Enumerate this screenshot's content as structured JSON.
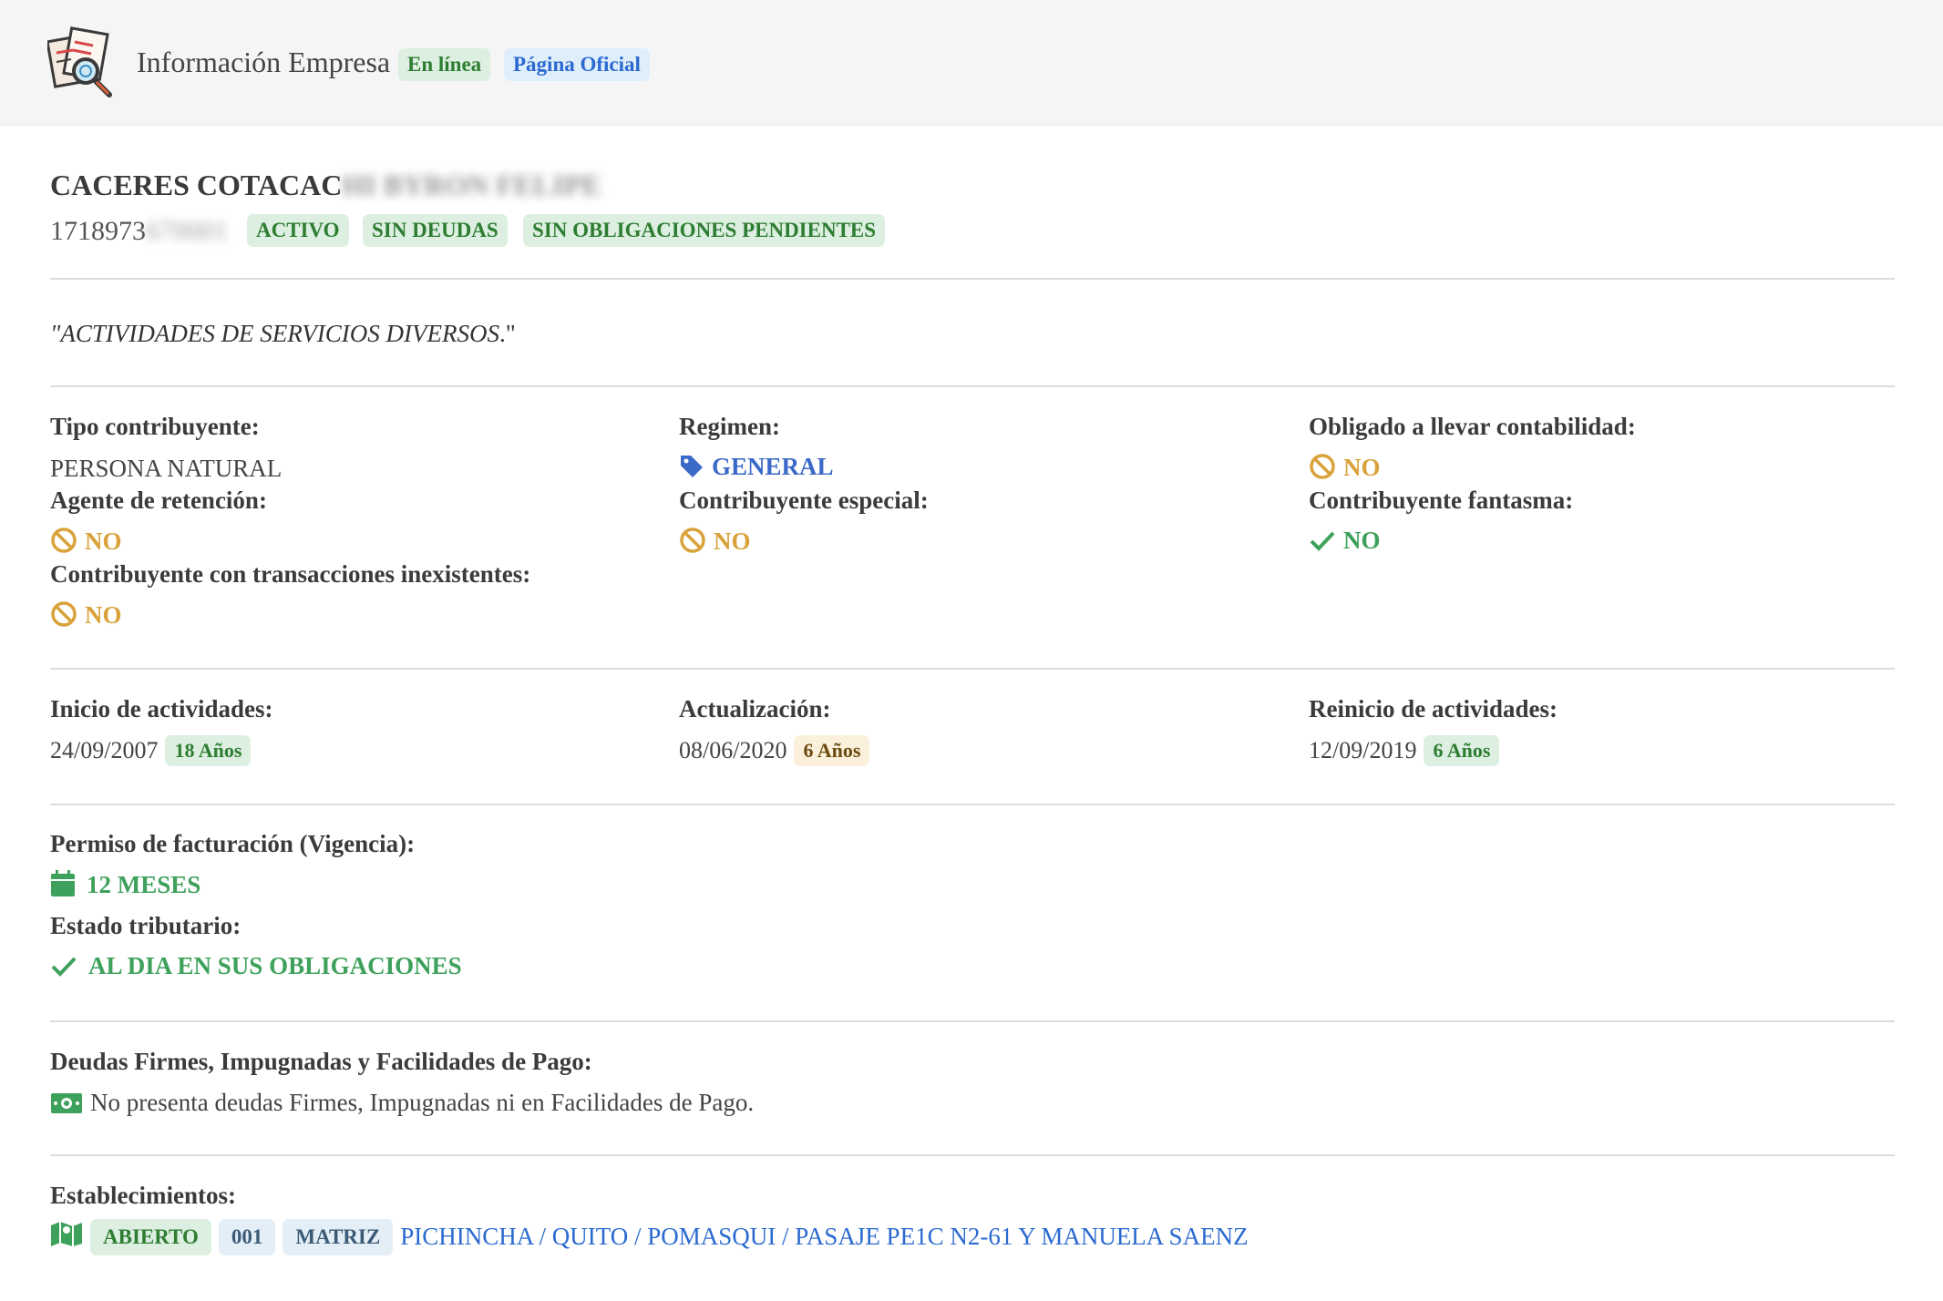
{
  "header": {
    "title": "Información Empresa",
    "badge_online": "En línea",
    "badge_official": "Página Oficial"
  },
  "company": {
    "name_visible": "CACERES COTACAC",
    "name_blurred": "HI BYRON FELIPE",
    "ruc_visible": "1718973",
    "ruc_blurred": "670001",
    "status_badges": [
      "ACTIVO",
      "SIN DEUDAS",
      "SIN OBLIGACIONES PENDIENTES"
    ],
    "activity_quote": "\"ACTIVIDADES DE SERVICIOS DIVERSOS",
    "activity_quote_tail": ".\""
  },
  "details": {
    "tipo_label": "Tipo contribuyente:",
    "tipo_value": "PERSONA NATURAL",
    "regimen_label": "Regimen:",
    "regimen_value": "GENERAL",
    "obligado_label": "Obligado a llevar contabilidad:",
    "obligado_value": "NO",
    "agente_label": "Agente de retención:",
    "agente_value": "NO",
    "especial_label": "Contribuyente especial:",
    "especial_value": "NO",
    "fantasma_label": "Contribuyente fantasma:",
    "fantasma_value": "NO",
    "inexistentes_label": "Contribuyente con transacciones inexistentes:",
    "inexistentes_value": "NO"
  },
  "dates": {
    "inicio_label": "Inicio de actividades:",
    "inicio_date": "24/09/2007",
    "inicio_age": "18 Años",
    "actualizacion_label": "Actualización:",
    "actualizacion_date": "08/06/2020",
    "actualizacion_age": "6 Años",
    "reinicio_label": "Reinicio de actividades:",
    "reinicio_date": "12/09/2019",
    "reinicio_age": "6 Años"
  },
  "billing": {
    "permiso_label": "Permiso de facturación (Vigencia):",
    "permiso_value": "12 MESES",
    "estado_label": "Estado tributario:",
    "estado_value": "AL DIA EN SUS OBLIGACIONES"
  },
  "debts": {
    "label": "Deudas Firmes, Impugnadas y Facilidades de Pago:",
    "text": "No presenta deudas Firmes, Impugnadas ni en Facilidades de Pago."
  },
  "establishments": {
    "label": "Establecimientos:",
    "status": "ABIERTO",
    "number": "001",
    "type": "MATRIZ",
    "address": "PICHINCHA / QUITO / POMASQUI / PASAJE PE1C N2-61 Y MANUELA SAENZ"
  },
  "colors": {
    "green": "#3ea15b",
    "amber": "#d9a23b",
    "blue": "#3a69c7"
  },
  "icons": {
    "logo": "documents-magnifier-icon",
    "regimen": "tag-icon",
    "no": "ban-icon",
    "yes": "check-icon",
    "permiso": "calendar-icon",
    "debts": "money-bill-icon",
    "establishments": "map-icon"
  }
}
